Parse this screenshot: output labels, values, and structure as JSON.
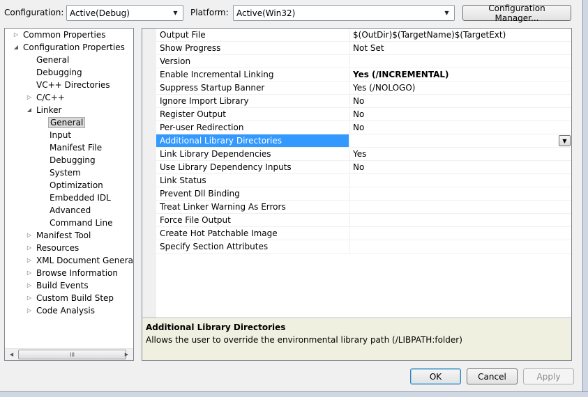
{
  "toolbar": {
    "configuration_label": "Configuration:",
    "configuration_value": "Active(Debug)",
    "platform_label": "Platform:",
    "platform_value": "Active(Win32)",
    "config_manager_label": "Configuration Manager..."
  },
  "tree": [
    {
      "label": "Common Properties",
      "level": 0,
      "expander": "collapsed"
    },
    {
      "label": "Configuration Properties",
      "level": 0,
      "expander": "expanded"
    },
    {
      "label": "General",
      "level": 1,
      "expander": "none"
    },
    {
      "label": "Debugging",
      "level": 1,
      "expander": "none"
    },
    {
      "label": "VC++ Directories",
      "level": 1,
      "expander": "none"
    },
    {
      "label": "C/C++",
      "level": 1,
      "expander": "collapsed"
    },
    {
      "label": "Linker",
      "level": 1,
      "expander": "expanded"
    },
    {
      "label": "General",
      "level": 2,
      "expander": "none",
      "selected": true
    },
    {
      "label": "Input",
      "level": 2,
      "expander": "none"
    },
    {
      "label": "Manifest File",
      "level": 2,
      "expander": "none"
    },
    {
      "label": "Debugging",
      "level": 2,
      "expander": "none"
    },
    {
      "label": "System",
      "level": 2,
      "expander": "none"
    },
    {
      "label": "Optimization",
      "level": 2,
      "expander": "none"
    },
    {
      "label": "Embedded IDL",
      "level": 2,
      "expander": "none"
    },
    {
      "label": "Advanced",
      "level": 2,
      "expander": "none"
    },
    {
      "label": "Command Line",
      "level": 2,
      "expander": "none"
    },
    {
      "label": "Manifest Tool",
      "level": 1,
      "expander": "collapsed"
    },
    {
      "label": "Resources",
      "level": 1,
      "expander": "collapsed"
    },
    {
      "label": "XML Document Generator",
      "level": 1,
      "expander": "collapsed"
    },
    {
      "label": "Browse Information",
      "level": 1,
      "expander": "collapsed"
    },
    {
      "label": "Build Events",
      "level": 1,
      "expander": "collapsed"
    },
    {
      "label": "Custom Build Step",
      "level": 1,
      "expander": "collapsed"
    },
    {
      "label": "Code Analysis",
      "level": 1,
      "expander": "collapsed"
    }
  ],
  "properties": [
    {
      "name": "Output File",
      "value": "$(OutDir)$(TargetName)$(TargetExt)"
    },
    {
      "name": "Show Progress",
      "value": "Not Set"
    },
    {
      "name": "Version",
      "value": ""
    },
    {
      "name": "Enable Incremental Linking",
      "value": "Yes (/INCREMENTAL)",
      "bold": true
    },
    {
      "name": "Suppress Startup Banner",
      "value": "Yes (/NOLOGO)"
    },
    {
      "name": "Ignore Import Library",
      "value": "No"
    },
    {
      "name": "Register Output",
      "value": "No"
    },
    {
      "name": "Per-user Redirection",
      "value": "No"
    },
    {
      "name": "Additional Library Directories",
      "value": "",
      "selected": true
    },
    {
      "name": "Link Library Dependencies",
      "value": "Yes"
    },
    {
      "name": "Use Library Dependency Inputs",
      "value": "No"
    },
    {
      "name": "Link Status",
      "value": ""
    },
    {
      "name": "Prevent Dll Binding",
      "value": ""
    },
    {
      "name": "Treat Linker Warning As Errors",
      "value": ""
    },
    {
      "name": "Force File Output",
      "value": ""
    },
    {
      "name": "Create Hot Patchable Image",
      "value": ""
    },
    {
      "name": "Specify Section Attributes",
      "value": ""
    }
  ],
  "description": {
    "title": "Additional Library Directories",
    "text": "Allows the user to override the environmental library path (/LIBPATH:folder)"
  },
  "buttons": {
    "ok": "OK",
    "cancel": "Cancel",
    "apply": "Apply"
  },
  "scrollbar": {
    "thumb_grip": "III"
  },
  "icons": {
    "collapsed": "▷",
    "expanded": "◢",
    "dropdown": "▼",
    "scroll_left": "◀",
    "scroll_right": "▶"
  }
}
